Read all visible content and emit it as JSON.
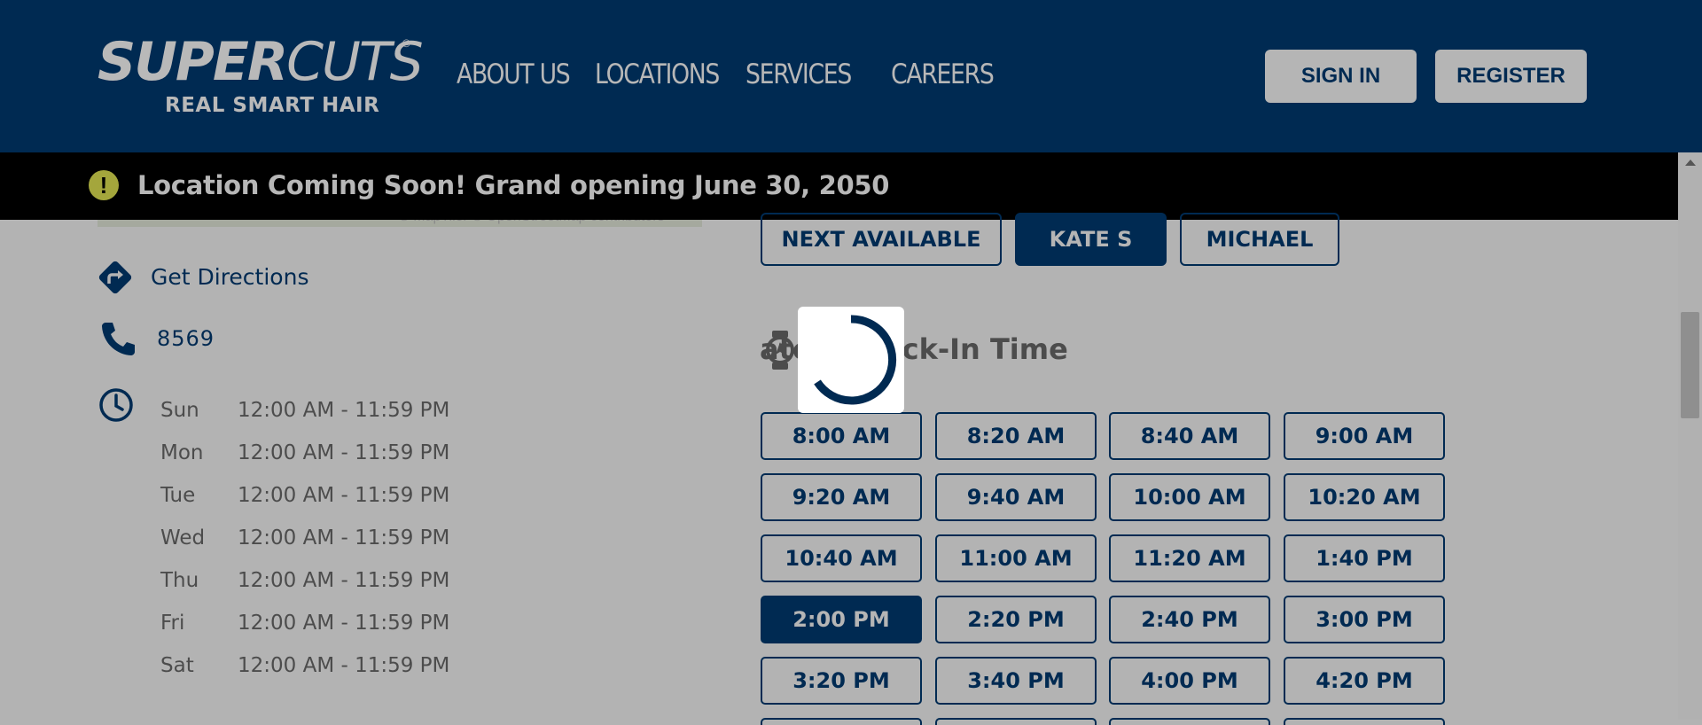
{
  "header": {
    "logo": {
      "word1": "SUPER",
      "word2": "CUTS",
      "registered": "®",
      "tagline": "REAL SMART HAIR"
    },
    "nav": [
      "ABOUT US",
      "LOCATIONS",
      "SERVICES",
      "CAREERS"
    ],
    "sign_in": "SIGN IN",
    "register": "REGISTER",
    "bg_color": "#002a52"
  },
  "banner": {
    "icon": "exclamation-icon",
    "text": "Location Coming Soon! Grand opening June 30, 2050"
  },
  "map": {
    "attribution": "© MapTiler © OpenStreetMap contributors"
  },
  "info": {
    "directions_label": "Get Directions",
    "phone": "8569",
    "hours": [
      {
        "day": "Sun",
        "time": "12:00 AM - 11:59 PM"
      },
      {
        "day": "Mon",
        "time": "12:00 AM - 11:59 PM"
      },
      {
        "day": "Tue",
        "time": "12:00 AM - 11:59 PM"
      },
      {
        "day": "Wed",
        "time": "12:00 AM - 11:59 PM"
      },
      {
        "day": "Thu",
        "time": "12:00 AM - 11:59 PM"
      },
      {
        "day": "Fri",
        "time": "12:00 AM - 11:59 PM"
      },
      {
        "day": "Sat",
        "time": "12:00 AM - 11:59 PM"
      }
    ]
  },
  "stylists": {
    "options": [
      "NEXT AVAILABLE",
      "KATE S",
      "MICHAEL"
    ],
    "selected": "KATE S"
  },
  "checkin": {
    "title_visible": "ated Check-In Time",
    "slots": [
      "8:00 AM",
      "8:20 AM",
      "8:40 AM",
      "9:00 AM",
      "9:20 AM",
      "9:40 AM",
      "10:00 AM",
      "10:20 AM",
      "10:40 AM",
      "11:00 AM",
      "11:20 AM",
      "1:40 PM",
      "2:00 PM",
      "2:20 PM",
      "2:40 PM",
      "3:00 PM",
      "3:20 PM",
      "3:40 PM",
      "4:00 PM",
      "4:20 PM"
    ],
    "selected": "2:00 PM"
  },
  "colors": {
    "brand": "#002a52",
    "overlay": "#b3b3b3",
    "alert_icon": "#a4a63c"
  }
}
